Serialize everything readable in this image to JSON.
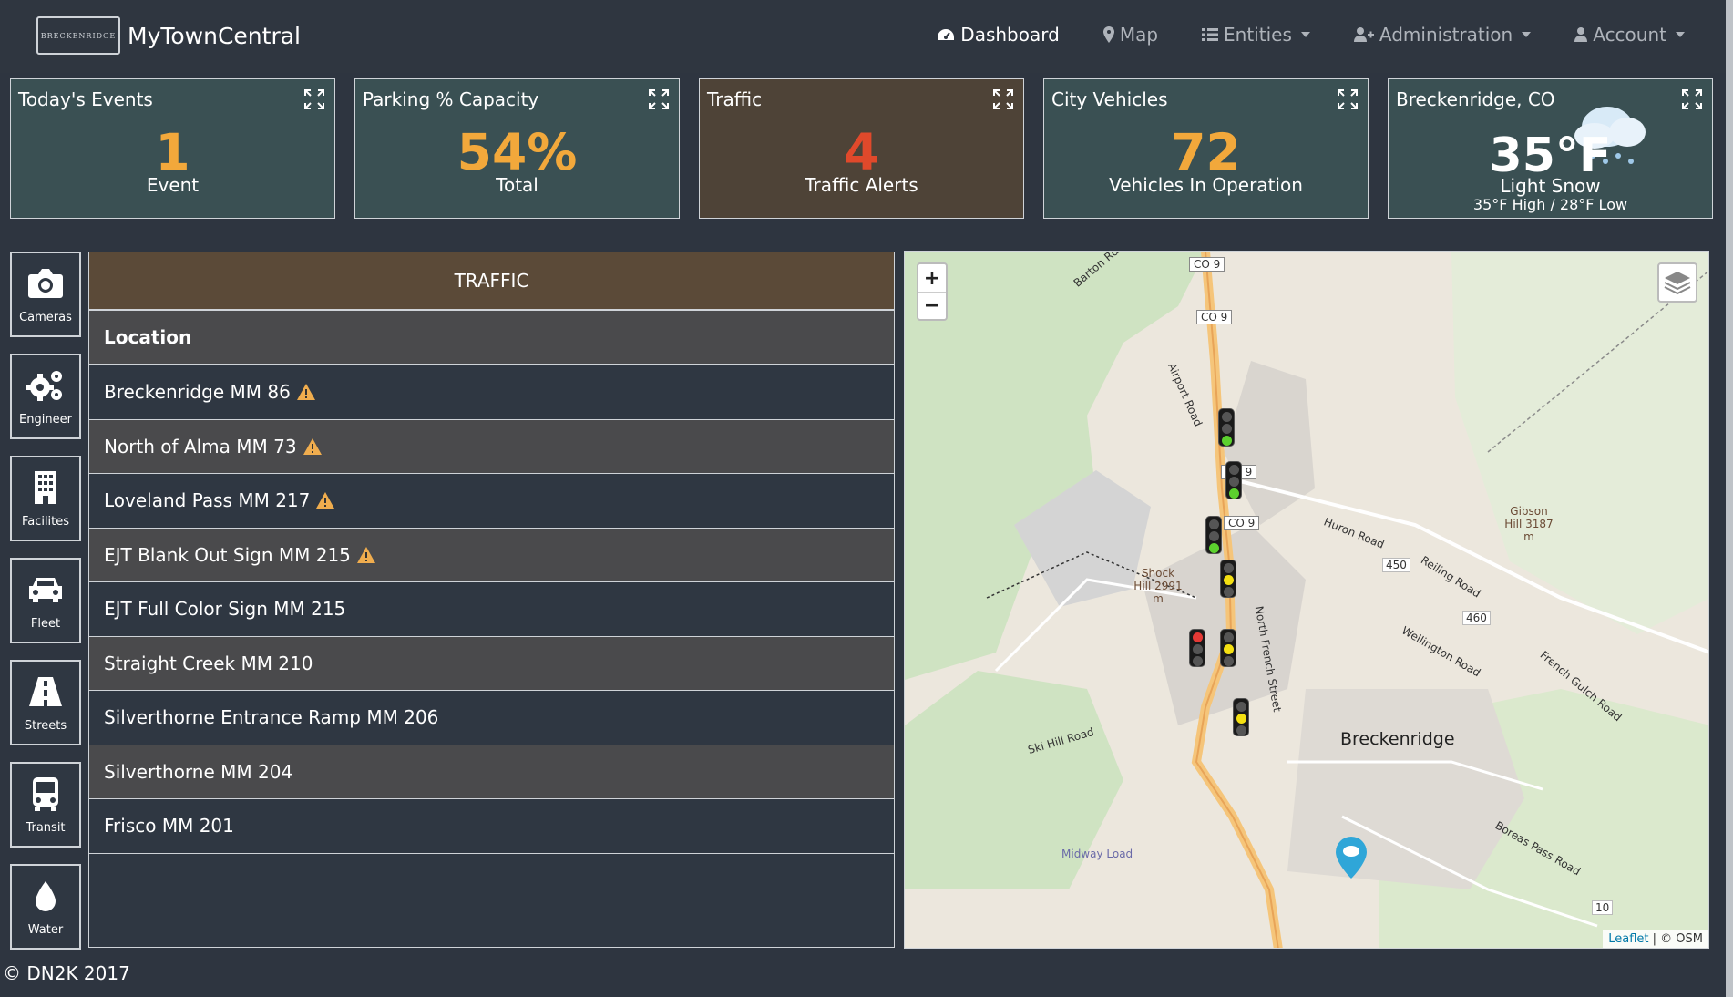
{
  "app": {
    "brand": "MyTownCentral",
    "logo_text": "BRECKENRIDGE"
  },
  "nav": [
    {
      "label": "Dashboard",
      "icon": "dashboard-icon",
      "dropdown": false,
      "active": true
    },
    {
      "label": "Map",
      "icon": "map-marker-icon",
      "dropdown": false,
      "active": false
    },
    {
      "label": "Entities",
      "icon": "list-icon",
      "dropdown": true,
      "active": false
    },
    {
      "label": "Administration",
      "icon": "user-plus-icon",
      "dropdown": true,
      "active": false
    },
    {
      "label": "Account",
      "icon": "user-icon",
      "dropdown": true,
      "active": false
    }
  ],
  "widgets": {
    "events": {
      "title": "Today's Events",
      "value": "1",
      "sub": "Event"
    },
    "parking": {
      "title": "Parking % Capacity",
      "value": "54%",
      "sub": "Total"
    },
    "traffic": {
      "title": "Traffic",
      "value": "4",
      "sub": "Traffic Alerts"
    },
    "vehicles": {
      "title": "City Vehicles",
      "value": "72",
      "sub": "Vehicles In Operation"
    },
    "weather": {
      "title": "Breckenridge, CO",
      "value": "35°F",
      "sub": "Light Snow",
      "detail": "35°F High / 28°F Low"
    }
  },
  "sidebar": [
    {
      "label": "Cameras",
      "icon": "camera-icon"
    },
    {
      "label": "Engineer",
      "icon": "gears-icon"
    },
    {
      "label": "Facilites",
      "icon": "building-icon"
    },
    {
      "label": "Fleet",
      "icon": "car-icon"
    },
    {
      "label": "Streets",
      "icon": "road-icon"
    },
    {
      "label": "Transit",
      "icon": "bus-icon"
    },
    {
      "label": "Water",
      "icon": "water-drop-icon"
    }
  ],
  "traffic_table": {
    "title": "TRAFFIC",
    "column": "Location",
    "rows": [
      {
        "location": "Breckenridge MM 86",
        "alert": true
      },
      {
        "location": "North of Alma MM 73",
        "alert": true
      },
      {
        "location": "Loveland Pass MM 217",
        "alert": true
      },
      {
        "location": "EJT Blank Out Sign MM 215",
        "alert": true
      },
      {
        "location": "EJT Full Color Sign MM 215",
        "alert": false
      },
      {
        "location": "Straight Creek MM 210",
        "alert": false
      },
      {
        "location": "Silverthorne Entrance Ramp MM 206",
        "alert": false
      },
      {
        "location": "Silverthorne MM 204",
        "alert": false
      },
      {
        "location": "Frisco MM 201",
        "alert": false
      }
    ]
  },
  "map": {
    "zoom_in": "+",
    "zoom_out": "−",
    "attribution_link": "Leaflet",
    "attribution_text": " | © OSM",
    "labels": [
      "CO 9",
      "CO 9",
      "CO 9",
      "CO 9",
      "Breckenridge",
      "Gibson Hill 3187 m",
      "Shock Hill 2991 m",
      "Huron Road",
      "Reiling Road",
      "Wellington Road",
      "French Gulch Road",
      "Ski Hill Road",
      "Boreas Pass Road",
      "Midway Load",
      "Airport Road",
      "North French Street",
      "Barton Rd",
      "450",
      "460",
      "10"
    ],
    "signals": [
      {
        "state": "green"
      },
      {
        "state": "green"
      },
      {
        "state": "green"
      },
      {
        "state": "yellow"
      },
      {
        "state": "red"
      },
      {
        "state": "yellow"
      },
      {
        "state": "yellow"
      }
    ]
  },
  "footer": "© DN2K 2017"
}
